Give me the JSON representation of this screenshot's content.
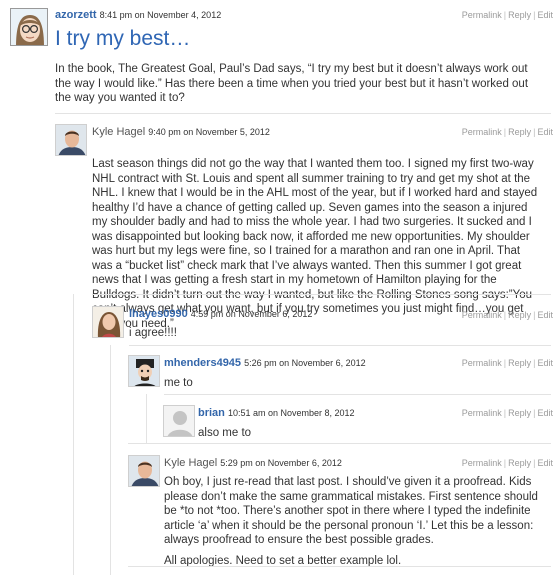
{
  "actions": {
    "permalink": "Permalink",
    "reply": "Reply",
    "edit": "Edit",
    "sep": "|"
  },
  "post": {
    "author": "azorzett",
    "date": "8:41 pm on November 4, 2012",
    "title": "I try my best…",
    "body": "In the book, The Greatest Goal, Paul’s Dad says, “I try my best but it doesn’t always work out the way I would like.” Has there been a time when you tried your best but it hasn’t worked out the way you wanted it to?"
  },
  "comments": {
    "c1": {
      "author": "Kyle Hagel",
      "date": "9:40 pm on November 5, 2012",
      "body": "Last season things did not go the way that I wanted them too. I signed my first two-way NHL contract with St. Louis and spent all summer training to try and get my shot at the NHL. I knew that I would be in the AHL most of the year, but if I worked hard and stayed healthy I’d have a chance of getting called up. Seven games into the season a injured my shoulder badly and had to miss the whole year. I had two surgeries. It sucked and I was disappointed but looking back now, it afforded me new opportunities. My shoulder was hurt but my legs were fine, so I trained for a marathon and ran one in April. That was a “bucket list” check mark that I’ve always wanted. Then this summer I got great news that I was getting a fresh start in my hometown of Hamilton playing for the Bulldogs. It didn’t turn out the way I wanted, but like the Rolling Stones song says:”You can’t always get what you want, but if you try sometimes you just might find…you get what you need.”"
    },
    "c2": {
      "author": "lhayes0990",
      "date": "4:59 pm on November 6, 2012",
      "body": "i agree!!!!"
    },
    "c3": {
      "author": "mhenders4945",
      "date": "5:26 pm on November 6, 2012",
      "body": "me to"
    },
    "c4": {
      "author": "brian",
      "date": "10:51 am on November 8, 2012",
      "body": "also me to"
    },
    "c5": {
      "author": "Kyle Hagel",
      "date": "5:29 pm on November 6, 2012",
      "body1": "Oh boy, I just re-read that last post. I should’ve given it a proofread. Kids please don’t make the same grammatical mistakes. First sentence should be *to not *too. There’s another spot in there where I typed the indefinite article ‘a’ when it should be the personal pronoun ‘I.’ Let this be a lesson: always proofread to ensure the best possible grades.",
      "body2": "All apologies. Need to set a better example lol."
    }
  }
}
